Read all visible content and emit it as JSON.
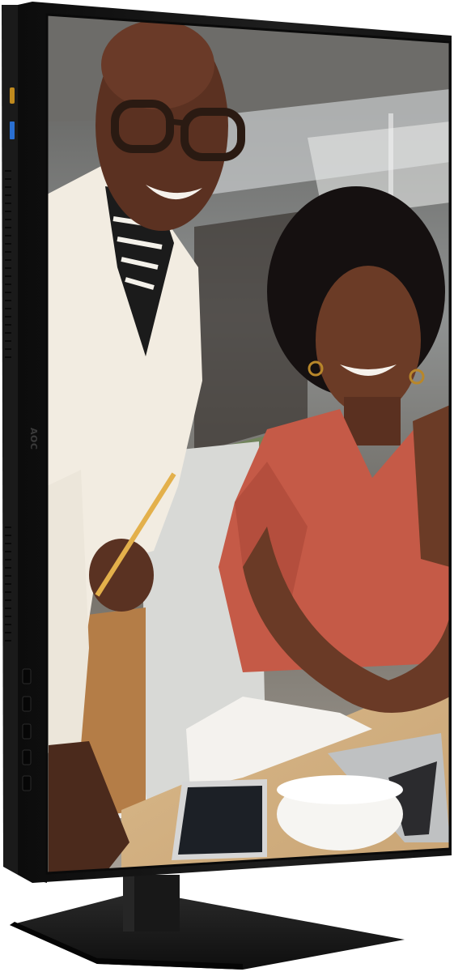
{
  "product": {
    "brand_logo": "AOC",
    "orientation": "portrait",
    "bezel_color": "#141414",
    "stand_color": "#1c1c1c"
  },
  "screen_content": {
    "description_icon": "photo-of-two-smiling-women",
    "subjects": [
      "person-standing-left",
      "person-seated-right"
    ]
  },
  "side_panel": {
    "ports": [
      "usb-c-port-icon",
      "usb-a-port-icon"
    ],
    "button_count": 5
  }
}
